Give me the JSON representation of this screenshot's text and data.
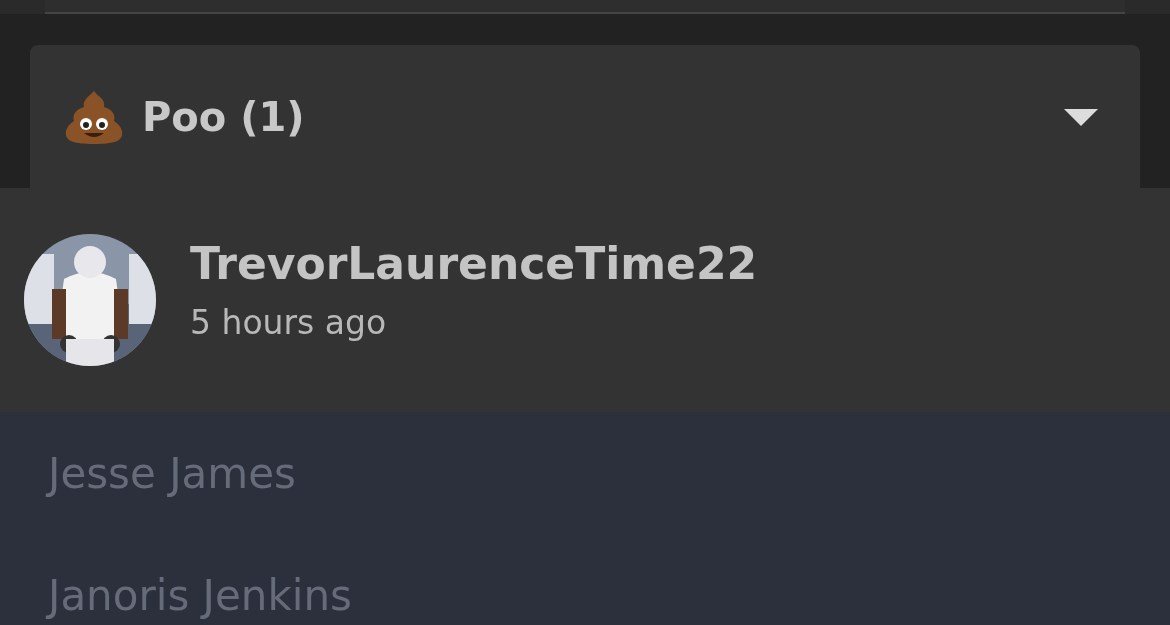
{
  "reaction": {
    "label": "Poo (1)",
    "expanded": true
  },
  "users": [
    {
      "name": "TrevorLaurenceTime22",
      "time": "5 hours ago"
    }
  ],
  "background_list": [
    "Jesse James",
    "Janoris Jenkins"
  ]
}
